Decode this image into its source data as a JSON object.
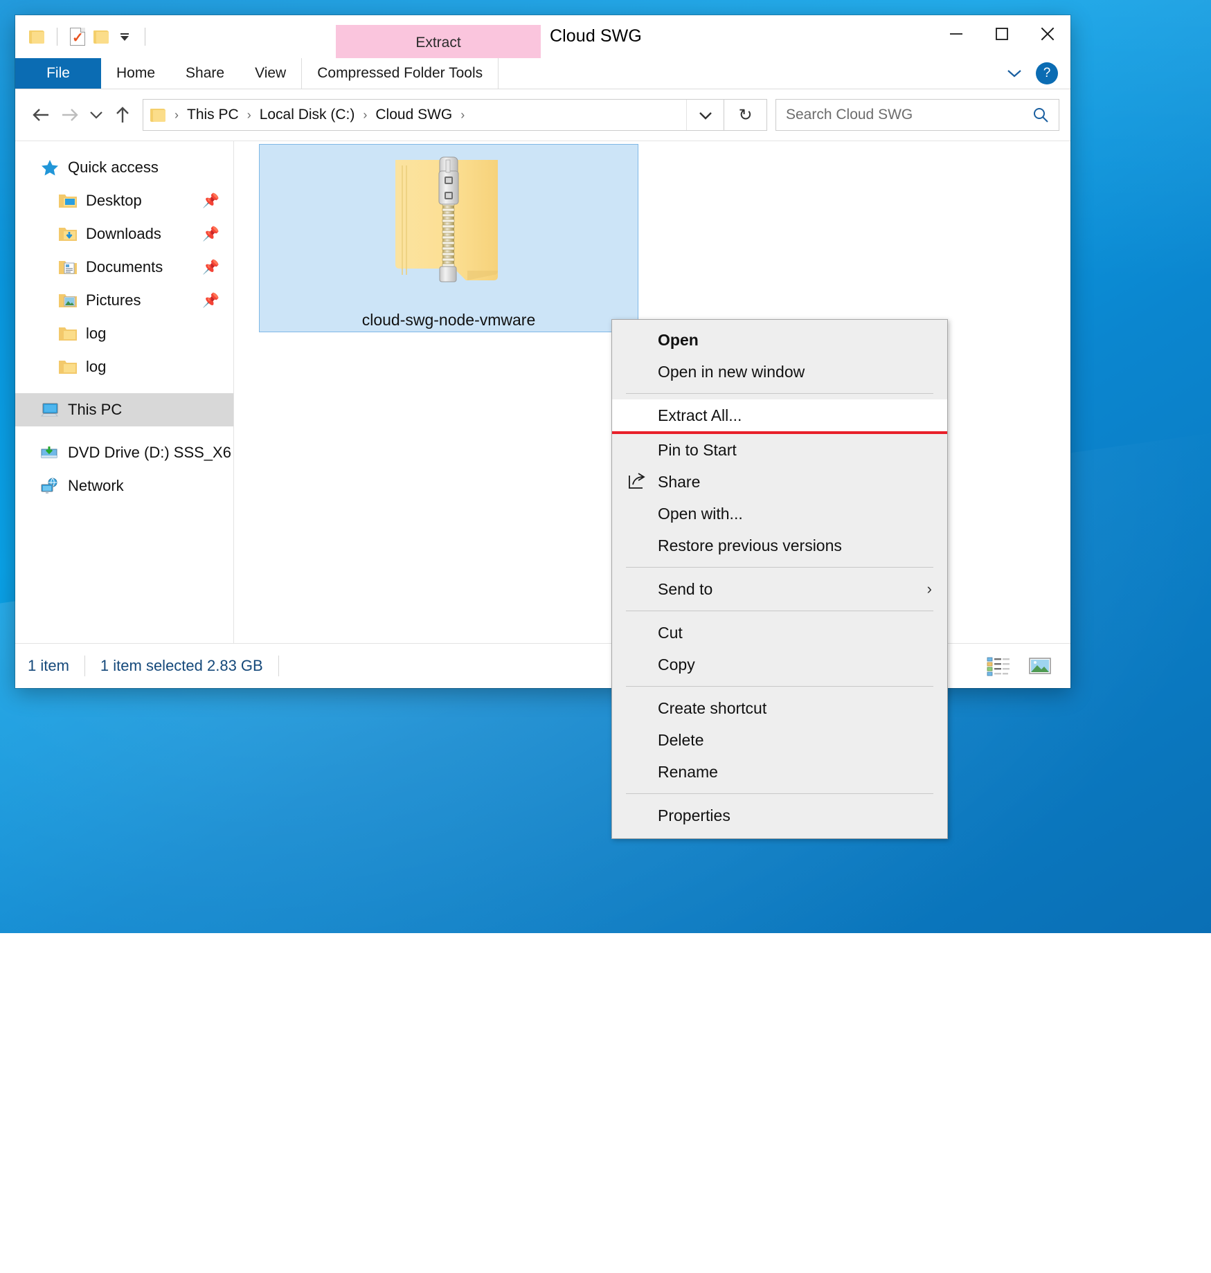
{
  "window": {
    "title": "Cloud SWG",
    "contextual_tab_group": "Extract",
    "minimize_label": "Minimize",
    "maximize_label": "Maximize",
    "close_label": "Close"
  },
  "quick_access_toolbar": {
    "items": [
      {
        "name": "folder-icon",
        "label": "Customize Quick Access Toolbar"
      },
      {
        "name": "properties-icon",
        "label": "Properties"
      },
      {
        "name": "new-folder-icon",
        "label": "New folder"
      },
      {
        "name": "dropdown-icon",
        "label": "Customize"
      }
    ]
  },
  "ribbon": {
    "tabs": [
      {
        "label": "File",
        "id": "file"
      },
      {
        "label": "Home",
        "id": "home"
      },
      {
        "label": "Share",
        "id": "share"
      },
      {
        "label": "View",
        "id": "view"
      },
      {
        "label": "Compressed Folder Tools",
        "id": "compressed-folder-tools"
      }
    ],
    "collapse_label": "Minimize the Ribbon",
    "help_label": "?"
  },
  "addressbar": {
    "back_label": "Back",
    "forward_label": "Forward",
    "recent_label": "Recent locations",
    "up_label": "Up",
    "breadcrumbs": [
      "This PC",
      "Local Disk (C:)",
      "Cloud SWG"
    ],
    "separator": "›",
    "dropdown_label": "Previous locations",
    "refresh_label": "Refresh",
    "refresh_glyph": "↻"
  },
  "search": {
    "placeholder": "Search Cloud SWG",
    "value": "",
    "icon": "search-icon"
  },
  "sidebar": {
    "items": [
      {
        "label": "Quick access",
        "icon": "star-icon",
        "level": 0,
        "pinned": false,
        "selected": false
      },
      {
        "label": "Desktop",
        "icon": "desktop-folder-icon",
        "level": 1,
        "pinned": true,
        "selected": false
      },
      {
        "label": "Downloads",
        "icon": "downloads-folder-icon",
        "level": 1,
        "pinned": true,
        "selected": false
      },
      {
        "label": "Documents",
        "icon": "documents-folder-icon",
        "level": 1,
        "pinned": true,
        "selected": false
      },
      {
        "label": "Pictures",
        "icon": "pictures-folder-icon",
        "level": 1,
        "pinned": true,
        "selected": false
      },
      {
        "label": "log",
        "icon": "folder-icon",
        "level": 1,
        "pinned": false,
        "selected": false
      },
      {
        "label": "log",
        "icon": "folder-icon",
        "level": 1,
        "pinned": false,
        "selected": false
      },
      {
        "label": "This PC",
        "icon": "this-pc-icon",
        "level": 0,
        "pinned": false,
        "selected": true
      },
      {
        "label": "DVD Drive (D:) SSS_X6",
        "icon": "dvd-drive-icon",
        "level": 0,
        "pinned": false,
        "selected": false
      },
      {
        "label": "Network",
        "icon": "network-icon",
        "level": 0,
        "pinned": false,
        "selected": false
      }
    ]
  },
  "content": {
    "files": [
      {
        "name": "cloud-swg-node-vmware",
        "icon": "zipped-folder-icon",
        "selected": true
      }
    ]
  },
  "statusbar": {
    "item_count": "1 item",
    "selection": "1 item selected  2.83 GB",
    "view_details_label": "Details view",
    "view_large_icons_label": "Large icons view"
  },
  "context_menu": {
    "items": [
      {
        "label": "Open",
        "bold": true,
        "icon": null,
        "highlight": false,
        "submenu": false
      },
      {
        "label": "Open in new window",
        "bold": false,
        "icon": null,
        "highlight": false,
        "submenu": false
      },
      {
        "separator_after": true
      },
      {
        "label": "Extract All...",
        "bold": false,
        "icon": null,
        "highlight": true,
        "submenu": false,
        "annotated": true
      },
      {
        "label": "Pin to Start",
        "bold": false,
        "icon": null,
        "highlight": false,
        "submenu": false
      },
      {
        "label": "Share",
        "bold": false,
        "icon": "share-icon",
        "highlight": false,
        "submenu": false
      },
      {
        "label": "Open with...",
        "bold": false,
        "icon": null,
        "highlight": false,
        "submenu": false
      },
      {
        "label": "Restore previous versions",
        "bold": false,
        "icon": null,
        "highlight": false,
        "submenu": false
      },
      {
        "separator_after": true
      },
      {
        "label": "Send to",
        "bold": false,
        "icon": null,
        "highlight": false,
        "submenu": true
      },
      {
        "separator_after": true
      },
      {
        "label": "Cut",
        "bold": false,
        "icon": null,
        "highlight": false,
        "submenu": false
      },
      {
        "label": "Copy",
        "bold": false,
        "icon": null,
        "highlight": false,
        "submenu": false
      },
      {
        "separator_after": true
      },
      {
        "label": "Create shortcut",
        "bold": false,
        "icon": null,
        "highlight": false,
        "submenu": false
      },
      {
        "label": "Delete",
        "bold": false,
        "icon": null,
        "highlight": false,
        "submenu": false
      },
      {
        "label": "Rename",
        "bold": false,
        "icon": null,
        "highlight": false,
        "submenu": false
      },
      {
        "separator_after": true
      },
      {
        "label": "Properties",
        "bold": false,
        "icon": null,
        "highlight": false,
        "submenu": false
      }
    ],
    "submenu_arrow": "›"
  },
  "colors": {
    "accent_blue": "#0b6cb3",
    "contextual_tab_pink": "#fac5dd",
    "selection_blue": "#cce4f7",
    "annotation_red": "#e8202a",
    "desktop_blue": "#0a8fd8",
    "status_text": "#14487a"
  }
}
